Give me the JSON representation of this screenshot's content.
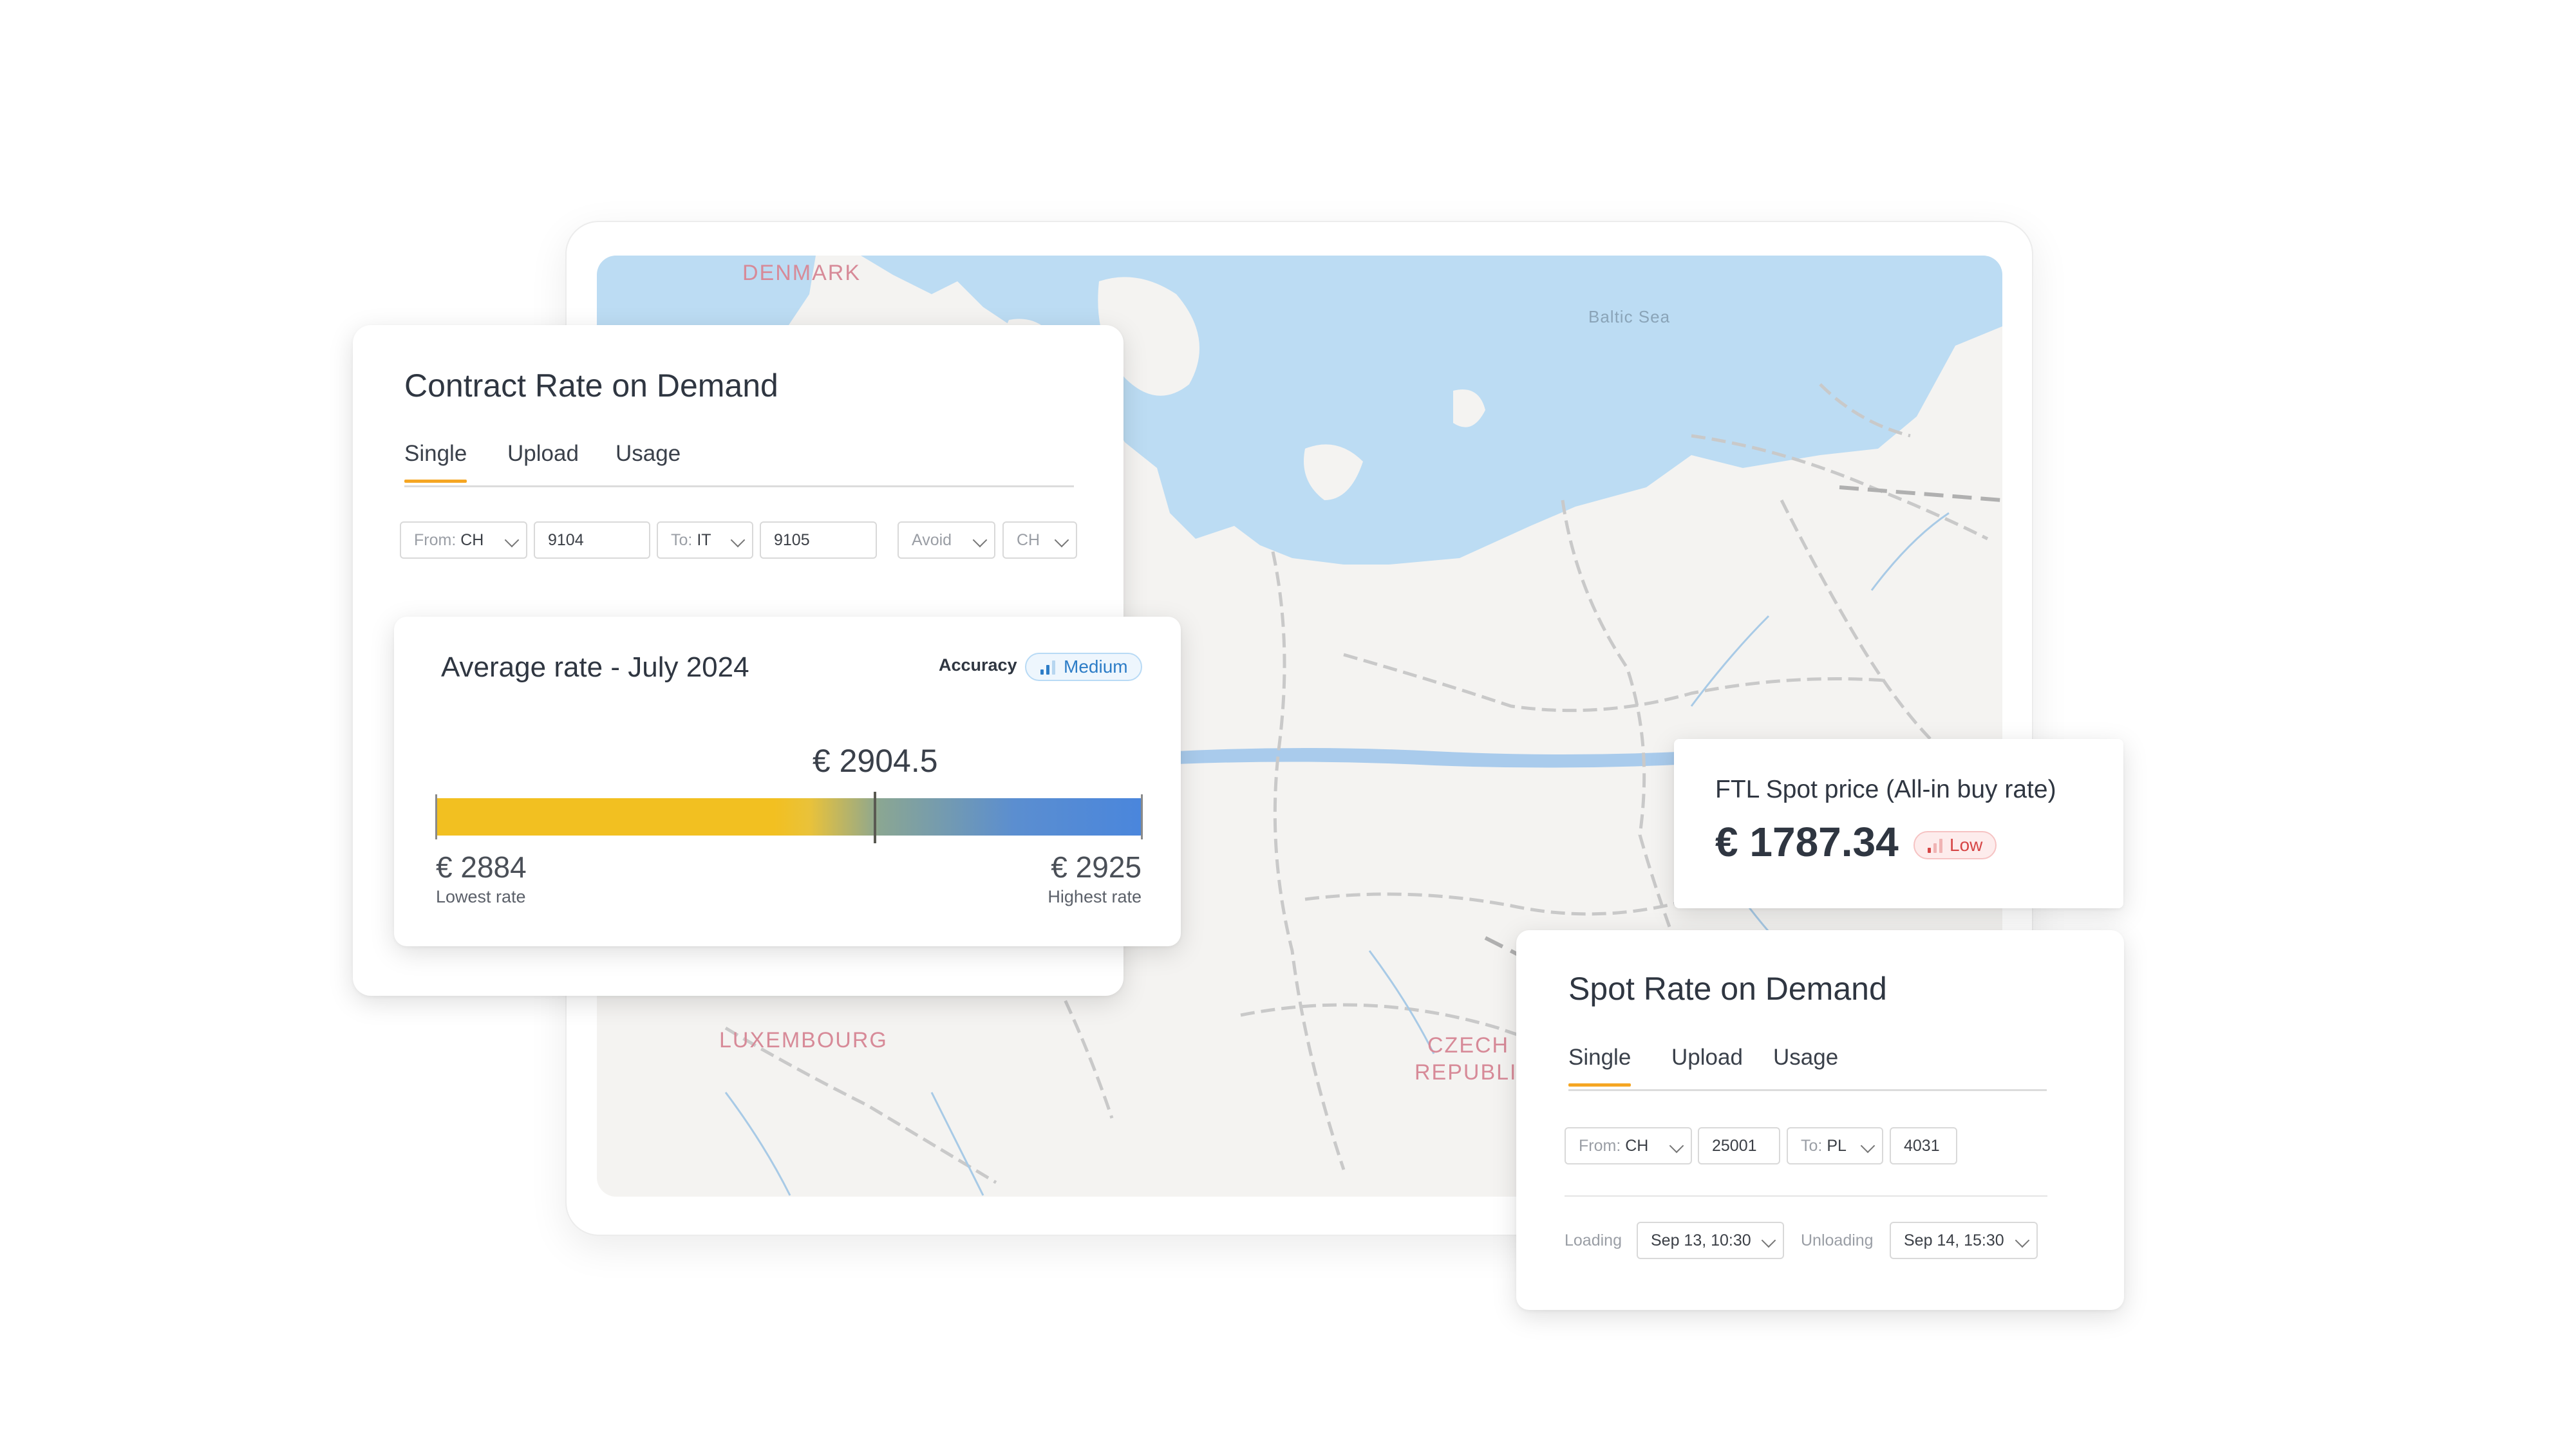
{
  "map": {
    "labels": {
      "denmark": "DENMARK",
      "baltic": "Baltic Sea",
      "luxembourg": "LUXEMBOURG",
      "czech_1": "CZECH",
      "czech_2": "REPUBLIC"
    }
  },
  "contract_card": {
    "title": "Contract Rate on Demand",
    "tabs": [
      "Single",
      "Upload",
      "Usage"
    ],
    "from_label": "From:",
    "from_value": "CH",
    "from_zip": "9104",
    "to_label": "To:",
    "to_value": "IT",
    "to_zip": "9105",
    "avoid_label": "Avoid",
    "avoid_value": "CH"
  },
  "average_card": {
    "title": "Average rate - July 2024",
    "accuracy_label": "Accuracy",
    "accuracy_value": "Medium",
    "average_value": "€ 2904.5",
    "average_fraction": 0.6225,
    "low_value": "€ 2884",
    "low_label": "Lowest rate",
    "high_value": "€ 2925",
    "high_label": "Highest rate",
    "colors": {
      "low": "#f2c021",
      "high": "#4a86dc"
    }
  },
  "spot_price_card": {
    "title": "FTL Spot price (All-in buy rate)",
    "value": "€ 1787.34",
    "accuracy_value": "Low"
  },
  "spot_card": {
    "title": "Spot Rate on Demand",
    "tabs": [
      "Single",
      "Upload",
      "Usage"
    ],
    "from_label": "From:",
    "from_value": "CH",
    "from_zip": "25001",
    "to_label": "To:",
    "to_value": "PL",
    "to_zip": "4031",
    "loading_label": "Loading",
    "loading_value": "Sep 13, 10:30",
    "unloading_label": "Unloading",
    "unloading_value": "Sep 14, 15:30"
  },
  "colors": {
    "accent": "#f5a623",
    "water": "#bcdcf3",
    "land": "#f4f3f1"
  }
}
